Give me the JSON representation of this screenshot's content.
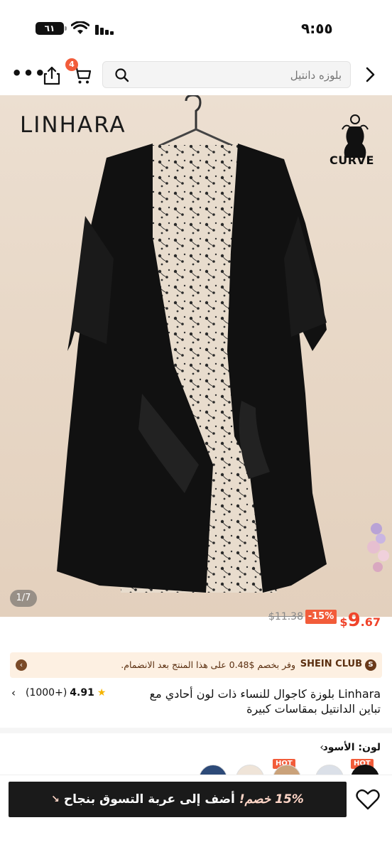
{
  "status_bar": {
    "time": "٩:٥٥",
    "battery": "٦١"
  },
  "header": {
    "cart_count": "4",
    "search_placeholder": "بلوزه دانتيل"
  },
  "product_image": {
    "brand": "LINHARA",
    "curve_label": "CURVE",
    "counter": "1/7"
  },
  "price": {
    "current_symbol": "$",
    "current_int": "9",
    "current_dec": ".67",
    "discount": "-15%",
    "original": "$11.38"
  },
  "club": {
    "icon": "S",
    "name": "SHEIN CLUB",
    "text": "وفر بخصم $0.48 على هذا المنتج بعد الانضمام."
  },
  "product": {
    "title": "Linhara بلوزة كاجوال للنساء ذات لون أحادي مع تباين الدانتيل بمقاسات كبيرة",
    "rating": "4.91",
    "reviews": "(1000+)"
  },
  "color": {
    "label": "لون: الأسود",
    "hot": "HOT"
  },
  "bottom_bar": {
    "promo": "15% خصم!",
    "action": "أضف إلى عربة التسوق بنجاح"
  },
  "colors": {
    "accent": "#f25c3a",
    "price": "#f0442b",
    "club_bg": "#fdf0e2"
  }
}
